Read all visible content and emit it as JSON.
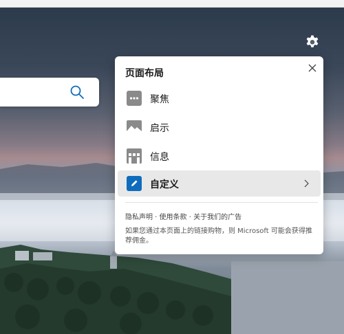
{
  "panel": {
    "title": "页面布局",
    "options": [
      {
        "label": "聚焦",
        "icon": "focused-layout-icon"
      },
      {
        "label": "启示",
        "icon": "inspirational-layout-icon"
      },
      {
        "label": "信息",
        "icon": "informational-layout-icon"
      },
      {
        "label": "自定义",
        "icon": "custom-edit-icon",
        "selected": true
      }
    ],
    "links": [
      "隐私声明",
      "使用条款",
      "关于我们的广告"
    ],
    "link_separator": " · ",
    "disclaimer": "如果您通过本页面上的链接购物，则 Microsoft 可能会获得推荐佣金。"
  },
  "icons": {
    "settings": "gear-icon",
    "search": "search-icon",
    "close": "close-icon",
    "chevron": "chevron-right-icon"
  },
  "colors": {
    "accent": "#0f6cbd",
    "icon_gray": "#8a8a8a",
    "selected_bg": "#e8e8e8"
  }
}
